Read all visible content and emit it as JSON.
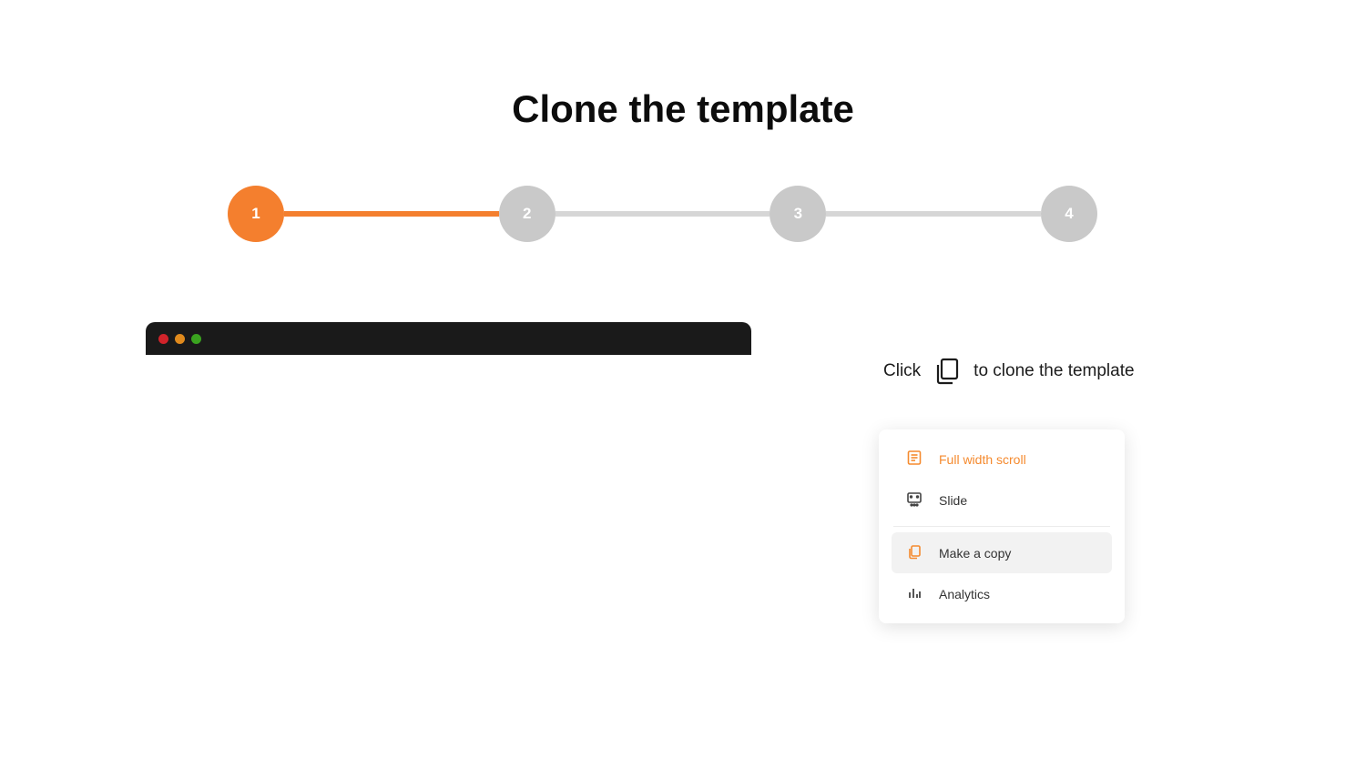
{
  "title": "Clone the template",
  "stepper": {
    "steps": [
      "1",
      "2",
      "3",
      "4"
    ],
    "active_index": 0
  },
  "hint": {
    "before": "Click",
    "after": "to clone the template",
    "icon": "copy-icon"
  },
  "menu": {
    "items": [
      {
        "label": "Full width scroll",
        "icon": "document-icon",
        "selected": true
      },
      {
        "label": "Slide",
        "icon": "slide-icon",
        "selected": false
      },
      {
        "label": "Make a copy",
        "icon": "copy-icon",
        "highlight": true
      },
      {
        "label": "Analytics",
        "icon": "bar-chart-icon"
      }
    ]
  },
  "colors": {
    "accent": "#f47f2e",
    "inactive": "#c9c9c9"
  }
}
